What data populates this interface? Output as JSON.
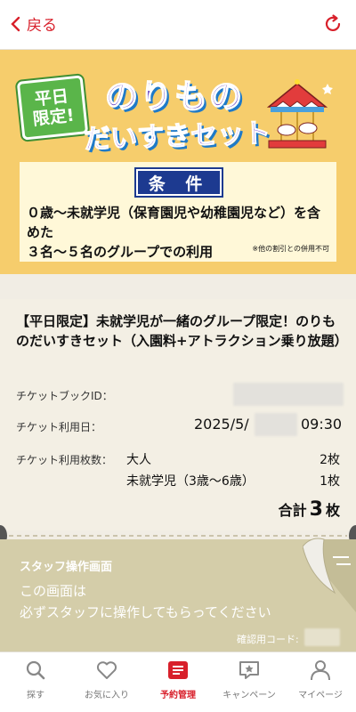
{
  "header": {
    "back_label": "戻る"
  },
  "banner": {
    "badge": "平日\n限定!",
    "title_line1": "のりもの",
    "title_line2": "だいすきセット",
    "condition_heading": "条 件",
    "condition_text": "０歳～未就学児（保育園児や幼稚園児など）を含めた\n３名～５名のグループでの利用",
    "condition_note": "※他の割引との併用不可"
  },
  "ticket": {
    "title": "【平日限定】未就学児が一緒のグループ限定！のりものだいすきセット（入園料+アトラクション乗り放題）",
    "book_id_label": "チケットブックID：",
    "date_label": "チケット利用日：",
    "date_value": "2025/5/",
    "time_value": "09:30",
    "count_label": "チケット利用枚数：",
    "counts": [
      {
        "name": "大人",
        "value": "2枚"
      },
      {
        "name": "未就学児（3歳～6歳）",
        "value": "1枚"
      }
    ],
    "total_prefix": "合計",
    "total_number": "3",
    "total_suffix": "枚"
  },
  "staff": {
    "title": "スタッフ操作画面",
    "message": "この画面は\n必ずスタッフに操作してもらってください",
    "code_label": "確認用コード:"
  },
  "tabs": [
    {
      "label": "探す",
      "icon": "search-icon"
    },
    {
      "label": "お気に入り",
      "icon": "heart-icon"
    },
    {
      "label": "予約管理",
      "icon": "reservation-icon",
      "active": true
    },
    {
      "label": "キャンペーン",
      "icon": "campaign-icon"
    },
    {
      "label": "マイページ",
      "icon": "person-icon"
    }
  ],
  "colors": {
    "accent": "#d8202b",
    "banner_bg": "#f6cd6c",
    "staff_bg": "#d4cda9",
    "condition_head": "#1d3a90"
  }
}
